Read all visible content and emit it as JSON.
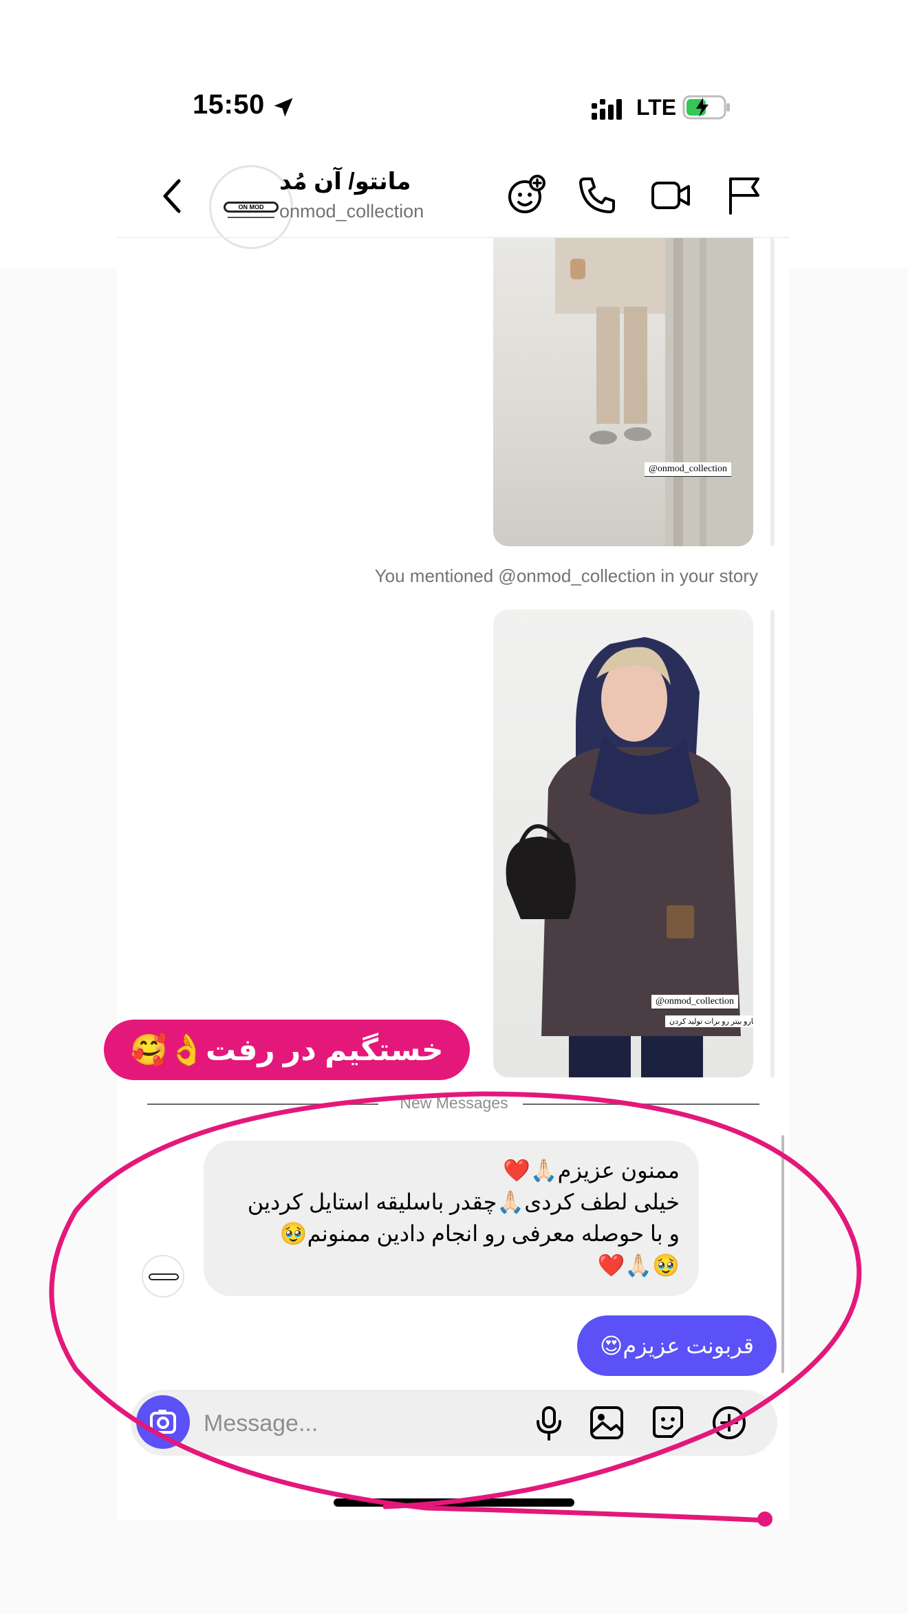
{
  "status_bar": {
    "time": "15:50",
    "network": "LTE"
  },
  "header": {
    "contact_name": "مانتو/ آن مُد",
    "contact_handle": "onmod_collection",
    "avatar_logo_text": "ON MOD"
  },
  "thread": {
    "story_tag": "@onmod_collection",
    "story2_caption": "زیباترین کارهارو بیتر رو برات تولید کردن",
    "mention_notice": "You mentioned @onmod_collection in your story",
    "overlay_label": "خستگیم در رفت👌🥰",
    "new_messages_label": "New Messages",
    "incoming_message": {
      "line1": "ممنون عزیزم🙏🏻❤️",
      "line2": "خیلی لطف کردی🙏🏻چقدر باسلیقه استایل کردین",
      "line3": "و با حوصله معرفی رو انجام دادین ممنونم🥹",
      "line4": "🥹🙏🏻❤️"
    },
    "outgoing_message": "قربونت عزیزم😍"
  },
  "composer": {
    "placeholder": "Message..."
  },
  "colors": {
    "accent": "#5b51f6",
    "annotation": "#e3187a",
    "bubble_incoming": "#efefef"
  },
  "icons": [
    "back-chevron-icon",
    "avatar-sticker-icon",
    "phone-icon",
    "video-camera-icon",
    "flag-icon",
    "camera-icon",
    "microphone-icon",
    "gallery-icon",
    "sticker-icon",
    "plus-icon",
    "location-arrow-icon",
    "signal-icon",
    "battery-icon"
  ]
}
